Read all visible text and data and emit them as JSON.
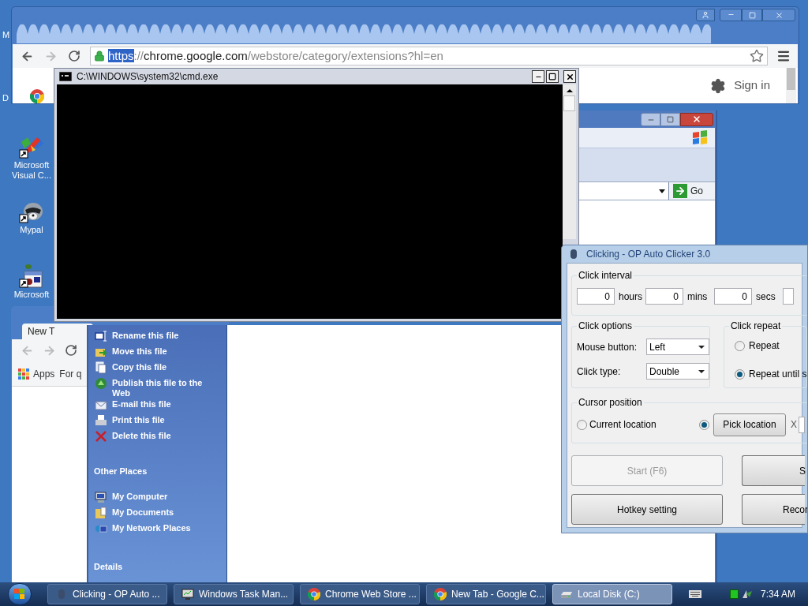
{
  "desktop": {
    "edge_labels": [
      "M",
      "D"
    ],
    "icons": [
      {
        "label": "Microsoft Visual C...",
        "kind": "visual"
      },
      {
        "label": "Mypal",
        "kind": "mypal"
      },
      {
        "label": "Microsoft",
        "kind": "calendar"
      }
    ]
  },
  "browser": {
    "url": {
      "scheme": "https",
      "scheme_selected": true,
      "separator": "://",
      "host": "chrome.google.com",
      "path": "/webstore/category/extensions?hl=en"
    },
    "sign_in": "Sign in"
  },
  "cmd": {
    "title": "C:\\WINDOWS\\system32\\cmd.exe"
  },
  "ie": {
    "go": "Go"
  },
  "browser_2": {
    "tab": "New T",
    "bookmarks": [
      "Apps",
      "For q"
    ]
  },
  "explorer": {
    "file_tasks": [
      {
        "label": "Rename this file",
        "kind": "rename"
      },
      {
        "label": "Move this file",
        "kind": "move"
      },
      {
        "label": "Copy this file",
        "kind": "copy"
      },
      {
        "label": "Publish this file to the Web",
        "kind": "publish"
      },
      {
        "label": "E-mail this file",
        "kind": "email"
      },
      {
        "label": "Print this file",
        "kind": "print"
      },
      {
        "label": "Delete this file",
        "kind": "delete"
      }
    ],
    "other_places": {
      "heading": "Other Places",
      "items": [
        {
          "label": "My Computer",
          "kind": "computer"
        },
        {
          "label": "My Documents",
          "kind": "documents"
        },
        {
          "label": "My Network Places",
          "kind": "network"
        }
      ]
    },
    "details": {
      "heading": "Details"
    }
  },
  "clicker": {
    "title": "Clicking - OP Auto Clicker 3.0",
    "interval": {
      "heading": "Click interval",
      "fields": [
        {
          "value": "0",
          "unit": "hours"
        },
        {
          "value": "0",
          "unit": "mins"
        },
        {
          "value": "0",
          "unit": "secs"
        }
      ]
    },
    "options": {
      "heading": "Click options",
      "rows": [
        {
          "label": "Mouse button:",
          "value": "Left"
        },
        {
          "label": "Click type:",
          "value": "Double"
        }
      ]
    },
    "repeat": {
      "heading": "Click repeat",
      "options": [
        {
          "label": "Repeat",
          "selected": false
        },
        {
          "label": "Repeat until s",
          "selected": true
        }
      ]
    },
    "cursor": {
      "heading": "Cursor position",
      "current": {
        "label": "Current location",
        "selected": false
      },
      "pick": {
        "label": "Pick location",
        "selected": true
      },
      "x_label": "X"
    },
    "buttons": [
      {
        "label": "Start (F6)",
        "disabled": true
      },
      {
        "label": "S",
        "disabled": false
      },
      {
        "label": "Hotkey setting",
        "disabled": false
      },
      {
        "label": "Recor",
        "disabled": false
      }
    ]
  },
  "taskbar": {
    "items": [
      {
        "label": "Clicking - OP Auto ...",
        "kind": "mouse",
        "selected": false
      },
      {
        "label": "Windows Task Man...",
        "kind": "taskmgr",
        "selected": false
      },
      {
        "label": "Chrome Web Store ...",
        "kind": "chrome",
        "selected": false
      },
      {
        "label": "New Tab - Google C...",
        "kind": "chrome",
        "selected": false
      },
      {
        "label": "Local Disk (C:)",
        "kind": "drive",
        "selected": true
      }
    ],
    "clock": "7:34 AM"
  }
}
